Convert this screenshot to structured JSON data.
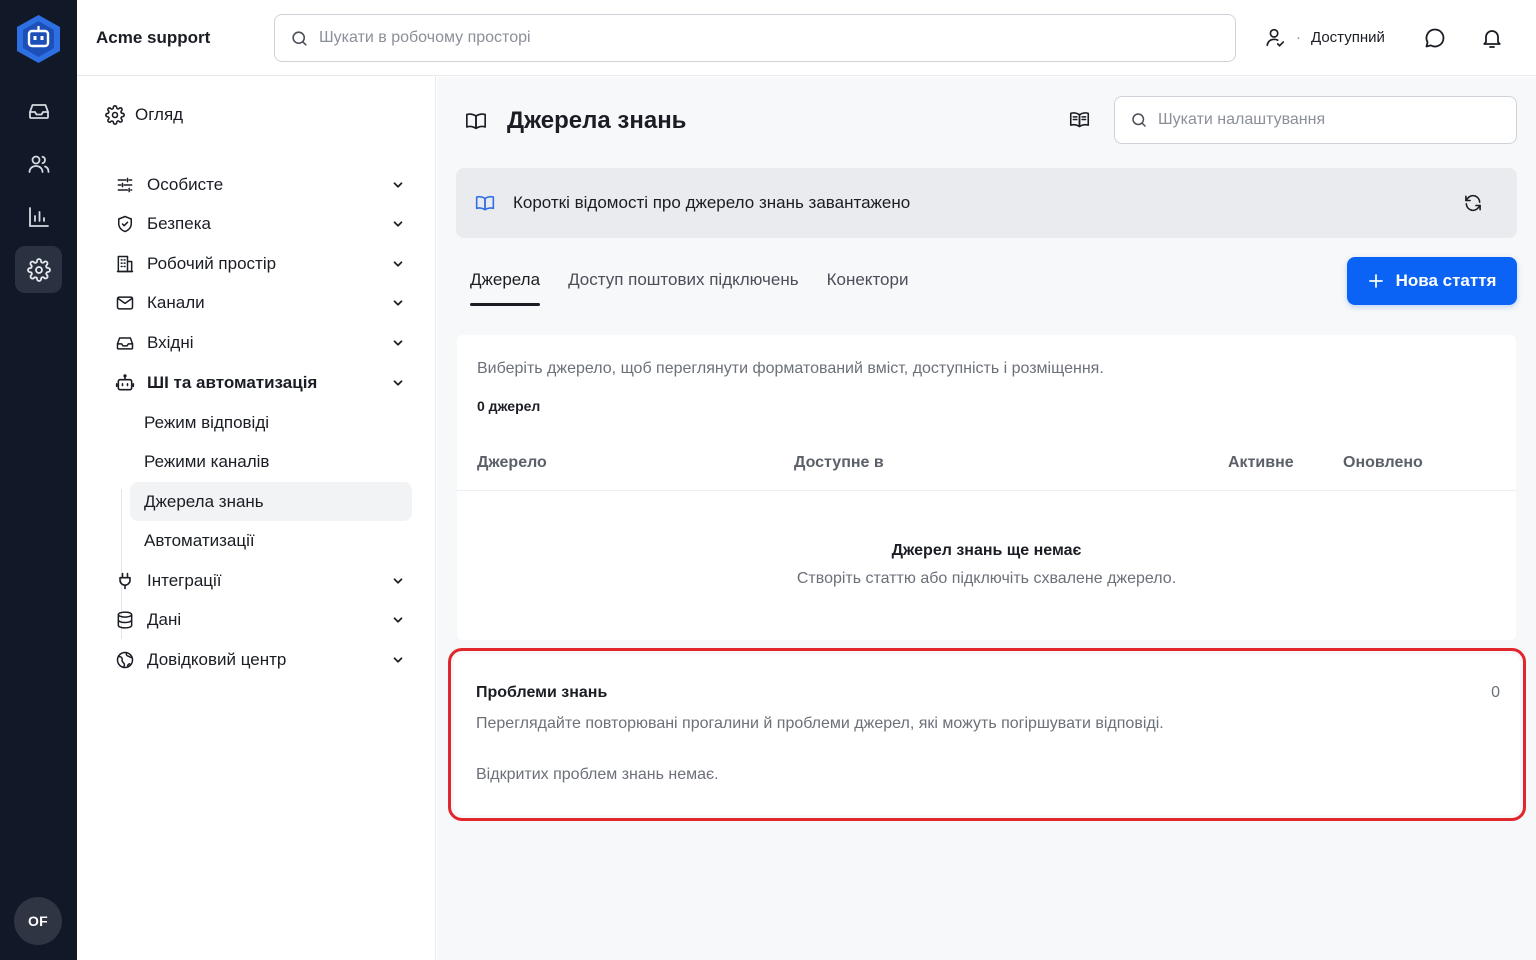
{
  "rail": {
    "items": [
      {
        "name": "inbox",
        "icon": "inbox-icon"
      },
      {
        "name": "contacts",
        "icon": "users-icon"
      },
      {
        "name": "reports",
        "icon": "bar-chart-icon"
      },
      {
        "name": "settings",
        "icon": "gear-icon",
        "active": true
      }
    ],
    "avatar_initials": "OF"
  },
  "topbar": {
    "workspace_name": "Acme support",
    "search_placeholder": "Шукати в робочому просторі",
    "status_label": "Доступний",
    "status_separator": "·"
  },
  "settings_nav": {
    "overview_label": "Огляд",
    "sections": [
      {
        "label": "Особисте",
        "icon": "sliders-icon"
      },
      {
        "label": "Безпека",
        "icon": "shield-icon"
      },
      {
        "label": "Робочий простір",
        "icon": "building-icon"
      },
      {
        "label": "Канали",
        "icon": "mail-icon"
      },
      {
        "label": "Вхідні",
        "icon": "inbox-icon"
      },
      {
        "label": "ШІ та автоматизація",
        "icon": "bot-icon",
        "expanded": true
      },
      {
        "label": "Інтеграції",
        "icon": "plug-icon"
      },
      {
        "label": "Дані",
        "icon": "database-icon"
      },
      {
        "label": "Довідковий центр",
        "icon": "globe-icon"
      }
    ],
    "ai_subitems": [
      {
        "label": "Режим відповіді"
      },
      {
        "label": "Режими каналів"
      },
      {
        "label": "Джерела знань",
        "active": true
      },
      {
        "label": "Автоматизації"
      }
    ]
  },
  "main": {
    "title": "Джерела знань",
    "settings_search_placeholder": "Шукати налаштування",
    "banner_text": "Короткі відомості про джерело знань завантажено",
    "tabs": [
      {
        "label": "Джерела",
        "active": true
      },
      {
        "label": "Доступ поштових підключень"
      },
      {
        "label": "Конектори"
      }
    ],
    "new_article_label": "Нова стаття",
    "sources": {
      "description": "Виберіть джерело, щоб переглянути форматований вміст, доступність і розміщення.",
      "count_label": "0 джерел",
      "columns": [
        "Джерело",
        "Доступне в",
        "Активне",
        "Оновлено"
      ],
      "empty_title": "Джерел знань ще немає",
      "empty_subtitle": "Створіть статтю або підключіть схвалене джерело."
    },
    "issues": {
      "title": "Проблеми знань",
      "count": "0",
      "description": "Переглядайте повторювані прогалини й проблеми джерел, які можуть погіршувати відповіді.",
      "empty_text": "Відкритих проблем знань немає."
    }
  },
  "colors": {
    "rail_bg": "#111827",
    "primary": "#0b63f6",
    "highlight": "#e1262d",
    "logo": "#2f6fe4"
  }
}
